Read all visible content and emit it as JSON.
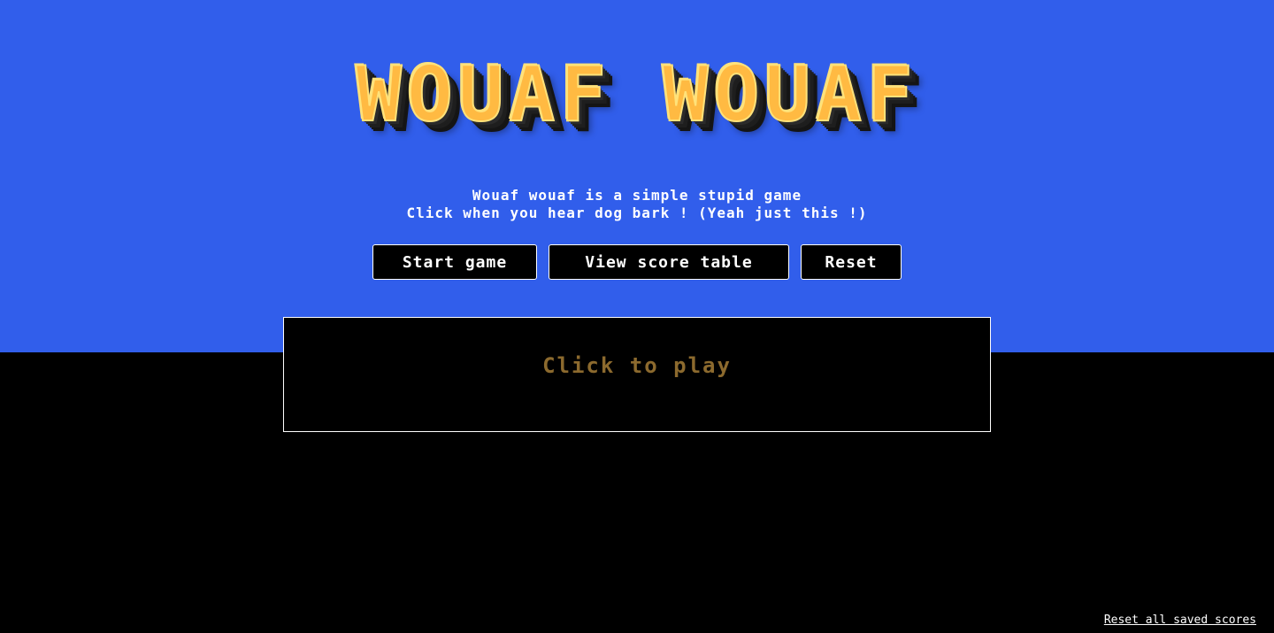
{
  "header": {
    "logo_text": "WOUAF WOUAF"
  },
  "intro": {
    "line1": "Wouaf wouaf is a simple stupid game",
    "line2": "Click when you hear dog bark ! (Yeah just this !)"
  },
  "buttons": {
    "start": "Start game",
    "score_table": "View score table",
    "reset": "Reset"
  },
  "play_area": {
    "prompt": "Click to play"
  },
  "footer": {
    "reset_scores_link": "Reset all saved scores"
  },
  "colors": {
    "background_top": "#315EEB",
    "background_bottom": "#000000",
    "logo_fill": "#FFBA42",
    "play_prompt": "#8C6A2E"
  }
}
